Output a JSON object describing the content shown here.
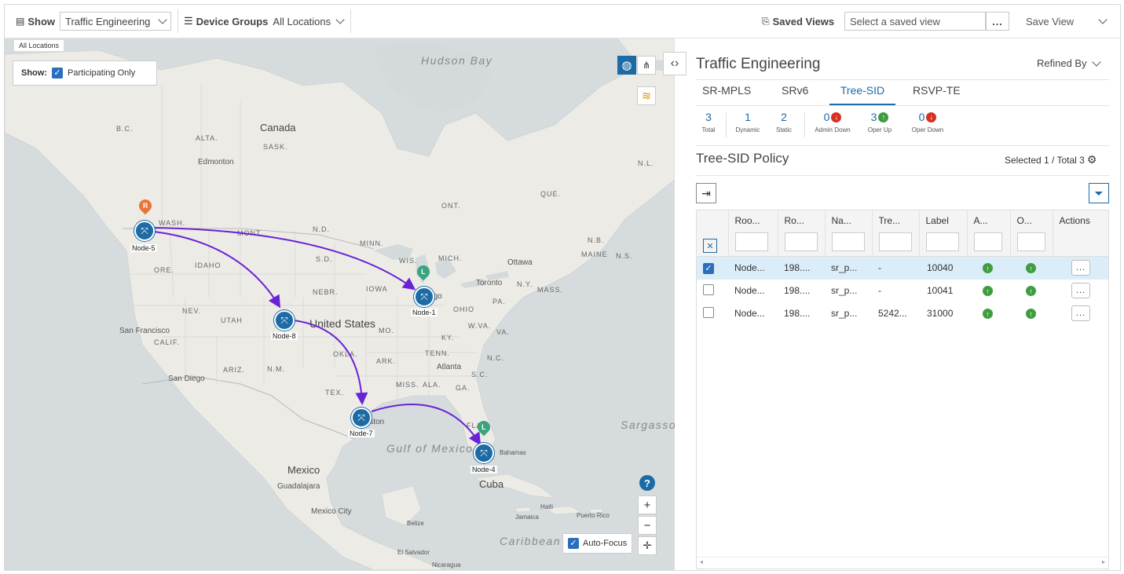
{
  "topbar": {
    "show_label": "Show",
    "show_value": "Traffic Engineering",
    "device_groups_label": "Device Groups",
    "device_groups_value": "All Locations",
    "saved_views_label": "Saved Views",
    "saved_view_placeholder": "Select a saved view",
    "more_label": "...",
    "save_view_label": "Save View"
  },
  "map": {
    "all_locations_label": "All Locations",
    "show_label": "Show:",
    "participating_only_label": "Participating Only",
    "participating_only_checked": true,
    "auto_focus_label": "Auto-Focus",
    "auto_focus_checked": true,
    "zoom_in_label": "+",
    "zoom_out_label": "−",
    "help_label": "?",
    "place_labels": {
      "hudson_bay": "Hudson Bay",
      "canada": "Canada",
      "united_states": "United States",
      "mexico": "Mexico",
      "gulf_of_mexico": "Gulf of Mexico",
      "sargasso_sea": "Sargasso Sea",
      "caribbean_sea": "Caribbean Sea",
      "edmonton": "Edmonton",
      "san_francisco": "San Francisco",
      "san_diego": "San Diego",
      "toronto": "Toronto",
      "ottawa": "Ottawa",
      "atlanta": "Atlanta",
      "chicago": "Chicago",
      "houston": "Houston",
      "guadalajara": "Guadalajara",
      "mexico_city": "Mexico City",
      "cuba": "Cuba",
      "bahamas": "Bahamas",
      "jamaica": "Jamaica",
      "haiti": "Haiti",
      "puerto_rico": "Puerto Rico",
      "belize": "Belize",
      "el_salvador": "El Salvador",
      "nicaragua": "Nicaragua",
      "bc": "B.C.",
      "alta": "ALTA.",
      "sask": "SASK.",
      "ont": "ONT.",
      "que": "QUE.",
      "nl": "N.L.",
      "nb": "N.B.",
      "ns": "N.S.",
      "wash": "WASH.",
      "ore": "ORE.",
      "idaho": "IDAHO",
      "mont": "MONT.",
      "nd": "N.D.",
      "sd": "S.D.",
      "minn": "MINN.",
      "wis": "WIS.",
      "mich": "MICH.",
      "iowa": "IOWA",
      "nebr": "NEBR.",
      "nev": "NEV.",
      "utah": "UTAH",
      "calif": "CALIF.",
      "ariz": "ARIZ.",
      "nm": "N.M.",
      "okla": "OKLA.",
      "tex": "TEX.",
      "mo": "MO.",
      "ark": "ARK.",
      "tenn": "TENN.",
      "ky": "KY.",
      "ohio": "OHIO",
      "pa": "PA.",
      "ny": "N.Y.",
      "wva": "W.VA.",
      "va": "VA.",
      "nc": "N.C.",
      "sc": "S.C.",
      "ga": "GA.",
      "miss": "MISS.",
      "ala": "ALA.",
      "fla": "FLA.",
      "maine": "MAINE",
      "mass": "MASS."
    },
    "nodes": [
      {
        "name": "Node-5"
      },
      {
        "name": "Node-1"
      },
      {
        "name": "Node-8"
      },
      {
        "name": "Node-7"
      },
      {
        "name": "Node-4"
      }
    ],
    "pins": {
      "root": "R",
      "leaf": "L"
    }
  },
  "panel": {
    "title": "Traffic Engineering",
    "refined_by": "Refined By",
    "tabs": [
      "SR-MPLS",
      "SRv6",
      "Tree-SID",
      "RSVP-TE"
    ],
    "active_tab": "Tree-SID",
    "stats": [
      {
        "value": "3",
        "label": "Total"
      },
      {
        "value": "1",
        "label": "Dynamic"
      },
      {
        "value": "2",
        "label": "Static"
      },
      {
        "value": "0",
        "label": "Admin Down"
      },
      {
        "value": "3",
        "label": "Oper Up"
      },
      {
        "value": "0",
        "label": "Oper Down"
      }
    ],
    "policy_title": "Tree-SID Policy",
    "selection_text": "Selected 1 / Total 3",
    "table": {
      "headers": [
        "Roo...",
        "Ro...",
        "Na...",
        "Tre...",
        "Label",
        "A...",
        "O...",
        "Actions"
      ],
      "rows": [
        {
          "root": "Node...",
          "ro": "198....",
          "name": "sr_p...",
          "tree": "-",
          "label": "10040",
          "selected": true
        },
        {
          "root": "Node...",
          "ro": "198....",
          "name": "sr_p...",
          "tree": "-",
          "label": "10041",
          "selected": false
        },
        {
          "root": "Node...",
          "ro": "198....",
          "name": "sr_p...",
          "tree": "5242...",
          "label": "31000",
          "selected": false
        }
      ],
      "more_label": "..."
    }
  },
  "colors": {
    "accent": "#1d6aa5",
    "path": "#6a22d6",
    "root_pin": "#e8743b",
    "leaf_pin": "#3aa37f",
    "up": "#3f9d3f",
    "down": "#d93025"
  }
}
